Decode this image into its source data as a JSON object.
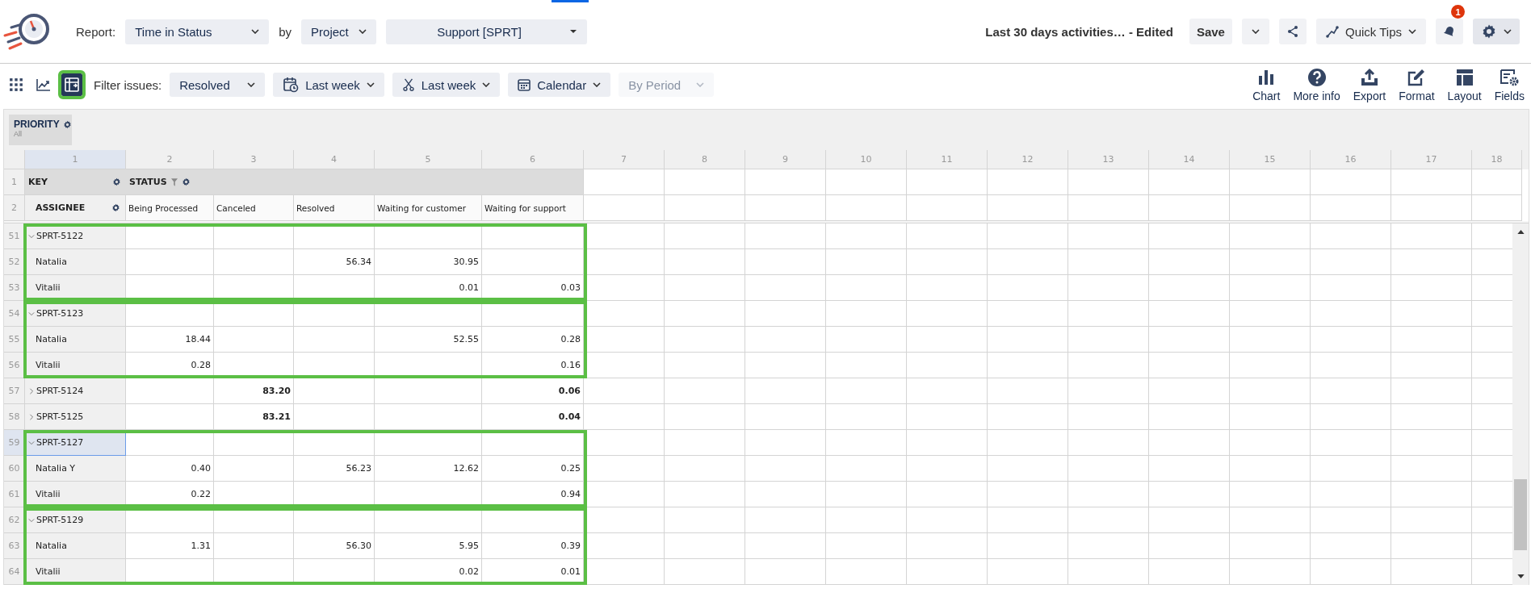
{
  "header": {
    "report_label": "Report:",
    "report": "Time in Status",
    "by_label": "by",
    "group_by": "Project",
    "project": "Support [SPRT]",
    "report_name": "Last 30 days activities… - Edited",
    "save": "Save",
    "quick_tips": "Quick Tips",
    "notifications": "1"
  },
  "toolbar": {
    "view_buttons": [
      {
        "selected": false,
        "highlighted": false
      },
      {
        "selected": false,
        "highlighted": false
      },
      {
        "selected": true,
        "highlighted": true
      }
    ],
    "filter_label": "Filter issues:",
    "filters": [
      {
        "label": "Resolved",
        "disabled": false
      },
      {
        "label": "Last week",
        "disabled": false
      },
      {
        "label": "Last week",
        "disabled": false
      },
      {
        "label": "Calendar",
        "disabled": false
      },
      {
        "label": "By Period",
        "disabled": true
      }
    ],
    "actions": [
      "Chart",
      "More info",
      "Export",
      "Format",
      "Layout",
      "Fields"
    ]
  },
  "pivot_filter": {
    "name": "PRIORITY",
    "value": "All"
  },
  "grid": {
    "columns": [
      {
        "label": "1",
        "selected": true
      },
      {
        "label": "2",
        "selected": false
      },
      {
        "label": "3",
        "selected": false
      },
      {
        "label": "4",
        "selected": false
      },
      {
        "label": "5",
        "selected": false
      },
      {
        "label": "6",
        "selected": false
      },
      {
        "label": "7",
        "selected": false
      },
      {
        "label": "8",
        "selected": false
      },
      {
        "label": "9",
        "selected": false
      },
      {
        "label": "10",
        "selected": false
      },
      {
        "label": "11",
        "selected": false
      },
      {
        "label": "12",
        "selected": false
      },
      {
        "label": "13",
        "selected": false
      },
      {
        "label": "14",
        "selected": false
      },
      {
        "label": "15",
        "selected": false
      },
      {
        "label": "16",
        "selected": false
      },
      {
        "label": "17",
        "selected": false
      },
      {
        "label": "18",
        "selected": false
      }
    ],
    "header_rows": [
      {
        "row": "1",
        "field": "KEY",
        "column_field": "STATUS"
      },
      {
        "row": "2",
        "field": "ASSIGNEE",
        "statuses": [
          "Being Processed",
          "Canceled",
          "Resolved",
          "Waiting for customer",
          "Waiting for support"
        ]
      }
    ],
    "issues": [
      {
        "row": "51",
        "key": "SPRT-5122",
        "expanded": true,
        "selected": false,
        "highlighted": true,
        "children": [
          {
            "row": "52",
            "name": "Natalia",
            "values": {
              "resolved": "56.34",
              "waiting_for_customer": "30.95"
            }
          },
          {
            "row": "53",
            "name": "Vitalii",
            "values": {
              "waiting_for_customer": "0.01",
              "waiting_for_support": "0.03"
            }
          }
        ]
      },
      {
        "row": "54",
        "key": "SPRT-5123",
        "expanded": true,
        "selected": false,
        "highlighted": true,
        "children": [
          {
            "row": "55",
            "name": "Natalia",
            "values": {
              "being_processed": "18.44",
              "waiting_for_customer": "52.55",
              "waiting_for_support": "0.28"
            }
          },
          {
            "row": "56",
            "name": "Vitalii",
            "values": {
              "being_processed": "0.28",
              "waiting_for_support": "0.16"
            }
          }
        ]
      },
      {
        "row": "57",
        "key": "SPRT-5124",
        "expanded": false,
        "selected": false,
        "highlighted": false,
        "values": {
          "canceled": "83.20",
          "waiting_for_support": "0.06"
        }
      },
      {
        "row": "58",
        "key": "SPRT-5125",
        "expanded": false,
        "selected": false,
        "highlighted": false,
        "values": {
          "canceled": "83.21",
          "waiting_for_support": "0.04"
        }
      },
      {
        "row": "59",
        "key": "SPRT-5127",
        "expanded": true,
        "selected": true,
        "highlighted": true,
        "children": [
          {
            "row": "60",
            "name": "Natalia Y",
            "values": {
              "being_processed": "0.40",
              "resolved": "56.23",
              "waiting_for_customer": "12.62",
              "waiting_for_support": "0.25"
            }
          },
          {
            "row": "61",
            "name": "Vitalii",
            "values": {
              "being_processed": "0.22",
              "waiting_for_support": "0.94"
            }
          }
        ]
      },
      {
        "row": "62",
        "key": "SPRT-5129",
        "expanded": true,
        "selected": false,
        "highlighted": true,
        "children": [
          {
            "row": "63",
            "name": "Natalia",
            "values": {
              "being_processed": "1.31",
              "resolved": "56.30",
              "waiting_for_customer": "5.95",
              "waiting_for_support": "0.39"
            }
          },
          {
            "row": "64",
            "name": "Vitalii",
            "values": {
              "waiting_for_customer": "0.02",
              "waiting_for_support": "0.01"
            }
          }
        ]
      }
    ]
  }
}
